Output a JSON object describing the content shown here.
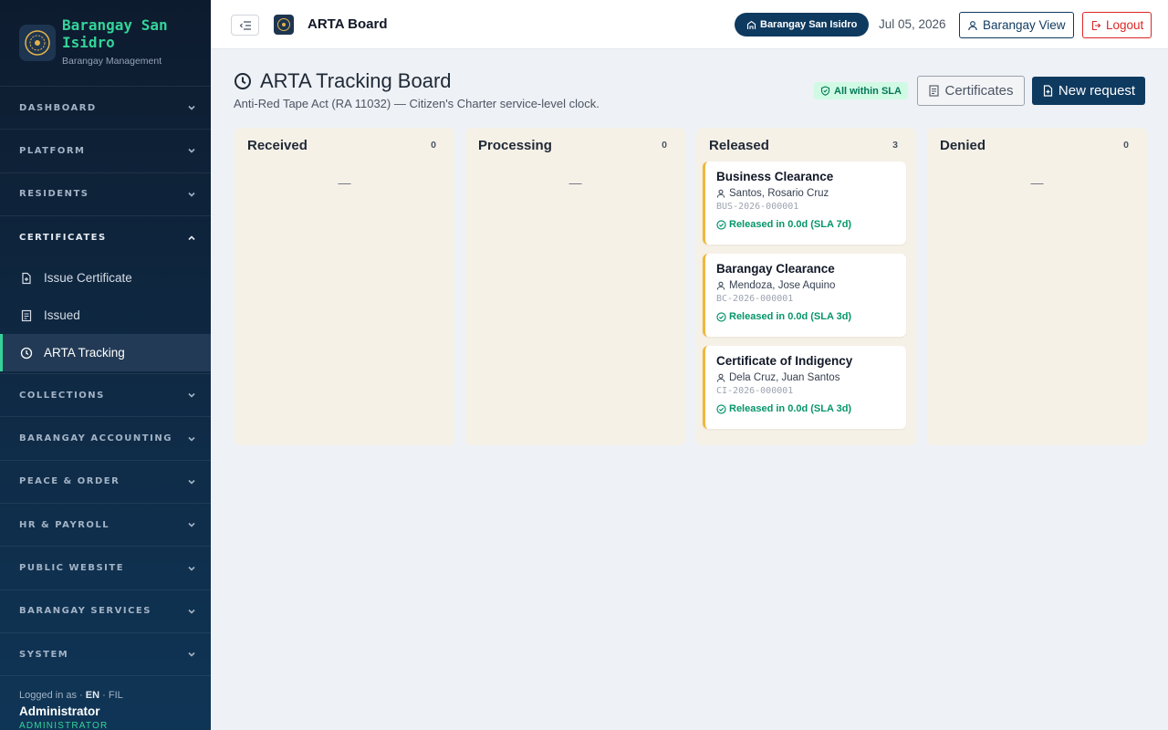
{
  "sidebar": {
    "brand_title": "Barangay San Isidro",
    "brand_subtitle": "Barangay Management",
    "sections_top": [
      {
        "label": "DASHBOARD"
      },
      {
        "label": "PLATFORM"
      },
      {
        "label": "RESIDENTS"
      }
    ],
    "open_section": {
      "label": "CERTIFICATES",
      "items": [
        {
          "label": "Issue Certificate",
          "icon": "file-plus-icon"
        },
        {
          "label": "Issued",
          "icon": "document-list-icon"
        },
        {
          "label": "ARTA Tracking",
          "icon": "clock-icon",
          "active": true
        }
      ]
    },
    "sections_bottom": [
      {
        "label": "COLLECTIONS"
      },
      {
        "label": "BARANGAY ACCOUNTING"
      },
      {
        "label": "PEACE & ORDER"
      },
      {
        "label": "HR & PAYROLL"
      },
      {
        "label": "PUBLIC WEBSITE"
      },
      {
        "label": "BARANGAY SERVICES"
      },
      {
        "label": "SYSTEM"
      }
    ],
    "user": {
      "logged_in_label": "Logged in as ·",
      "lang_en": "EN",
      "lang_sep": "·",
      "lang_fil": "FIL",
      "name": "Administrator",
      "role": "ADMINISTRATOR"
    }
  },
  "topbar": {
    "title": "ARTA Board",
    "barangay_pill": "Barangay San Isidro",
    "date": "Jul 05, 2026",
    "view_button": "Barangay View",
    "logout_button": "Logout"
  },
  "page": {
    "title": "ARTA Tracking Board",
    "subtitle": "Anti-Red Tape Act (RA 11032) — Citizen's Charter service-level clock.",
    "sla_badge": "All within SLA",
    "certificates_button": "Certificates",
    "new_request_button": "New request"
  },
  "board": {
    "empty_marker": "—",
    "columns": [
      {
        "name": "Received",
        "count": "0",
        "cards": []
      },
      {
        "name": "Processing",
        "count": "0",
        "cards": []
      },
      {
        "name": "Released",
        "count": "3",
        "cards": [
          {
            "title": "Business Clearance",
            "person": "Santos, Rosario Cruz",
            "ref": "BUS-2026-000001",
            "status": "Released in 0.0d (SLA 7d)"
          },
          {
            "title": "Barangay Clearance",
            "person": "Mendoza, Jose Aquino",
            "ref": "BC-2026-000001",
            "status": "Released in 0.0d (SLA 3d)"
          },
          {
            "title": "Certificate of Indigency",
            "person": "Dela Cruz, Juan Santos",
            "ref": "CI-2026-000001",
            "status": "Released in 0.0d (SLA 3d)"
          }
        ]
      },
      {
        "name": "Denied",
        "count": "0",
        "cards": []
      }
    ]
  },
  "colors": {
    "accent_green": "#34d399",
    "primary_navy": "#0f3a5f",
    "danger": "#dc2626",
    "card_accent": "#f0b73a",
    "column_bg": "#f6f1e7"
  }
}
